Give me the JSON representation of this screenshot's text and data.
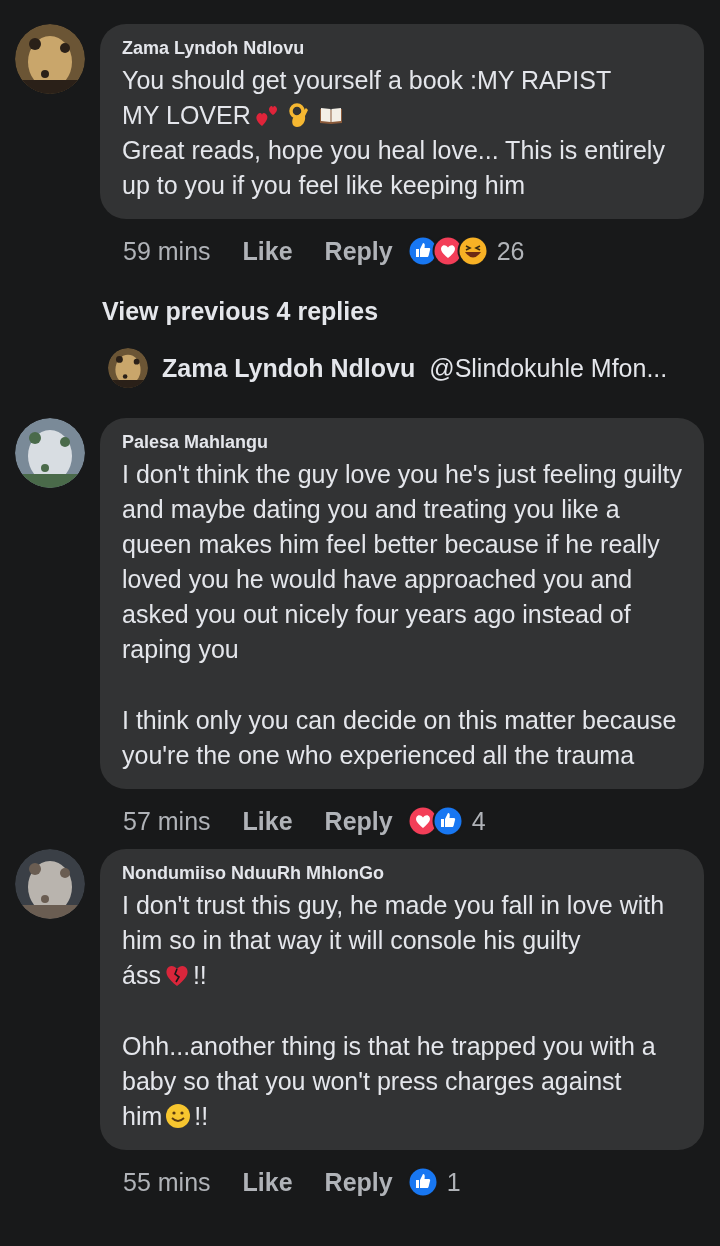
{
  "comments": [
    {
      "author": "Zama Lyndoh Ndlovu",
      "avatar": {
        "kind": "picture"
      },
      "paragraphs": [
        {
          "gap_before": false,
          "lines": [
            [
              {
                "kind": "text",
                "text": "You should get yourself a book :MY RAPIST"
              }
            ],
            [
              {
                "kind": "text",
                "text": "MY LOVER"
              },
              {
                "kind": "hearts"
              },
              {
                "kind": "okhand"
              },
              {
                "kind": "book"
              }
            ]
          ]
        },
        {
          "gap_before": false,
          "lines": [
            [
              {
                "kind": "text",
                "text": "Great reads, hope you heal love... This is entirely up to you if you feel like keeping him"
              }
            ]
          ]
        }
      ],
      "time": "59 mins",
      "like": "Like",
      "reply": "Reply",
      "reactions": [
        {
          "kind": "like"
        },
        {
          "kind": "love"
        },
        {
          "kind": "haha"
        }
      ],
      "count": "26",
      "more_replies": "View previous 4 replies",
      "reply_preview": {
        "author": "Zama Lyndoh Ndlovu",
        "avatar": {
          "kind": "picture"
        },
        "text": "@Slindokuhle Mfon..."
      }
    },
    {
      "author": "Palesa Mahlangu",
      "avatar": {
        "kind": "picture"
      },
      "paragraphs": [
        {
          "gap_before": false,
          "lines": [
            [
              {
                "kind": "text",
                "text": "I don't think the guy love you he's just feeling guilty and maybe dating you and treating you like a queen makes him feel better because if he really loved you he would have approached you and asked you out nicely four years ago instead of raping you"
              }
            ]
          ]
        },
        {
          "gap_before": true,
          "lines": [
            [
              {
                "kind": "text",
                "text": "I think only you can decide on this matter because you're the one who experienced all the trauma"
              }
            ]
          ]
        }
      ],
      "time": "57 mins",
      "like": "Like",
      "reply": "Reply",
      "reactions": [
        {
          "kind": "love"
        },
        {
          "kind": "like"
        }
      ],
      "count": "4"
    },
    {
      "author": "Nondumiiso NduuRh MhlonGo",
      "avatar": {
        "kind": "picture"
      },
      "paragraphs": [
        {
          "gap_before": false,
          "lines": [
            [
              {
                "kind": "text",
                "text": "I don't trust this guy, he made you fall in love with him so in that way it will console his guilty"
              }
            ],
            [
              {
                "kind": "text",
                "text": "áss"
              },
              {
                "kind": "brokenheart"
              },
              {
                "kind": "text",
                "text": "!!"
              }
            ]
          ]
        },
        {
          "gap_before": true,
          "lines": [
            [
              {
                "kind": "text",
                "text": "Ohh...another thing is that he trapped you with a baby so that you won't press charges against"
              }
            ],
            [
              {
                "kind": "text",
                "text": "him"
              },
              {
                "kind": "smile"
              },
              {
                "kind": "text",
                "text": "!!"
              }
            ]
          ]
        }
      ],
      "time": "55 mins",
      "like": "Like",
      "reply": "Reply",
      "reactions": [
        {
          "kind": "like"
        }
      ],
      "count": "1"
    }
  ]
}
